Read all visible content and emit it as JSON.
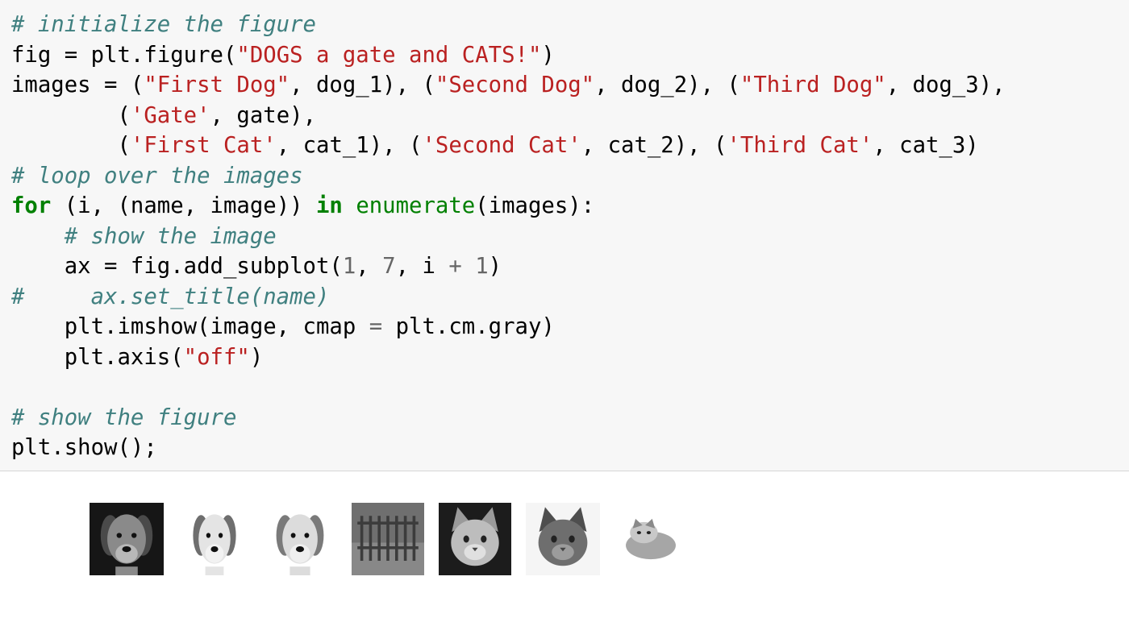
{
  "code_cell": {
    "lines": [
      [
        {
          "t": "# initialize the figure",
          "c": "cm"
        }
      ],
      [
        {
          "t": "fig = plt.figure(",
          "c": "pl"
        },
        {
          "t": "\"DOGS a gate and CATS!\"",
          "c": "st"
        },
        {
          "t": ")",
          "c": "pl"
        }
      ],
      [
        {
          "t": "images = (",
          "c": "pl"
        },
        {
          "t": "\"First Dog\"",
          "c": "st"
        },
        {
          "t": ", dog_1), (",
          "c": "pl"
        },
        {
          "t": "\"Second Dog\"",
          "c": "st"
        },
        {
          "t": ", dog_2), (",
          "c": "pl"
        },
        {
          "t": "\"Third Dog\"",
          "c": "st"
        },
        {
          "t": ", dog_3),",
          "c": "pl"
        }
      ],
      [
        {
          "t": "        (",
          "c": "pl"
        },
        {
          "t": "'Gate'",
          "c": "st"
        },
        {
          "t": ", gate),",
          "c": "pl"
        }
      ],
      [
        {
          "t": "        (",
          "c": "pl"
        },
        {
          "t": "'First Cat'",
          "c": "st"
        },
        {
          "t": ", cat_1), (",
          "c": "pl"
        },
        {
          "t": "'Second Cat'",
          "c": "st"
        },
        {
          "t": ", cat_2), (",
          "c": "pl"
        },
        {
          "t": "'Third Cat'",
          "c": "st"
        },
        {
          "t": ", cat_3)",
          "c": "pl"
        }
      ],
      [
        {
          "t": "# loop over the images",
          "c": "cm"
        }
      ],
      [
        {
          "t": "for",
          "c": "kw"
        },
        {
          "t": " (i, (name, image)) ",
          "c": "pl"
        },
        {
          "t": "in",
          "c": "kw"
        },
        {
          "t": " ",
          "c": "pl"
        },
        {
          "t": "enumerate",
          "c": "nm"
        },
        {
          "t": "(images):",
          "c": "pl"
        }
      ],
      [
        {
          "t": "    ",
          "c": "pl"
        },
        {
          "t": "# show the image",
          "c": "cm"
        }
      ],
      [
        {
          "t": "    ax = fig.add_subplot(",
          "c": "pl"
        },
        {
          "t": "1",
          "c": "op"
        },
        {
          "t": ", ",
          "c": "pl"
        },
        {
          "t": "7",
          "c": "op"
        },
        {
          "t": ", i ",
          "c": "pl"
        },
        {
          "t": "+",
          "c": "op"
        },
        {
          "t": " ",
          "c": "pl"
        },
        {
          "t": "1",
          "c": "op"
        },
        {
          "t": ")",
          "c": "pl"
        }
      ],
      [
        {
          "t": "#     ax.set_title(name)",
          "c": "cm"
        }
      ],
      [
        {
          "t": "    plt.imshow(image, cmap ",
          "c": "pl"
        },
        {
          "t": "=",
          "c": "op"
        },
        {
          "t": " plt.cm.gray)",
          "c": "pl"
        }
      ],
      [
        {
          "t": "    plt.axis(",
          "c": "pl"
        },
        {
          "t": "\"off\"",
          "c": "st"
        },
        {
          "t": ")",
          "c": "pl"
        }
      ],
      [
        {
          "t": "",
          "c": "pl"
        }
      ],
      [
        {
          "t": "# show the figure",
          "c": "cm"
        }
      ],
      [
        {
          "t": "plt.show();",
          "c": "pl"
        }
      ]
    ]
  },
  "syntax_colors": {
    "comment": "#408080",
    "string": "#ba2121",
    "keyword": "#008000",
    "number": "#666666",
    "text": "#000000",
    "cell_background": "#f7f7f7"
  },
  "output": {
    "images": [
      {
        "icon": "dog-portrait-icon",
        "kind": "dog",
        "bg": "#161616",
        "fur": "#8a8a8a",
        "face": "#b8b8b8",
        "ear": "#4a4a4a"
      },
      {
        "icon": "puppy-portrait-icon",
        "kind": "dog",
        "bg": "#ffffff",
        "fur": "#e4e4e4",
        "face": "#f2f2f2",
        "ear": "#6e6e6e"
      },
      {
        "icon": "puppy-portrait-icon",
        "kind": "dog",
        "bg": "#ffffff",
        "fur": "#dcdcdc",
        "face": "#efefef",
        "ear": "#7a7a7a"
      },
      {
        "icon": "gate-image-icon",
        "kind": "gate",
        "bg": "#6f6f6f",
        "fur": "#5a5a5a",
        "face": "#888888",
        "ear": "#3c3c3c"
      },
      {
        "icon": "kitten-portrait-icon",
        "kind": "cat",
        "bg": "#1c1c1c",
        "fur": "#bdbdbd",
        "face": "#e0e0e0",
        "ear": "#9a9a9a"
      },
      {
        "icon": "tabby-cat-icon",
        "kind": "cat",
        "bg": "#f5f5f5",
        "fur": "#6e6e6e",
        "face": "#9c9c9c",
        "ear": "#4e4e4e"
      },
      {
        "icon": "fluffy-kitten-icon",
        "kind": "fluffy",
        "bg": "#ffffff",
        "fur": "#a6a6a6",
        "face": "#c8c8c8",
        "ear": "#8a8a8a"
      }
    ]
  }
}
